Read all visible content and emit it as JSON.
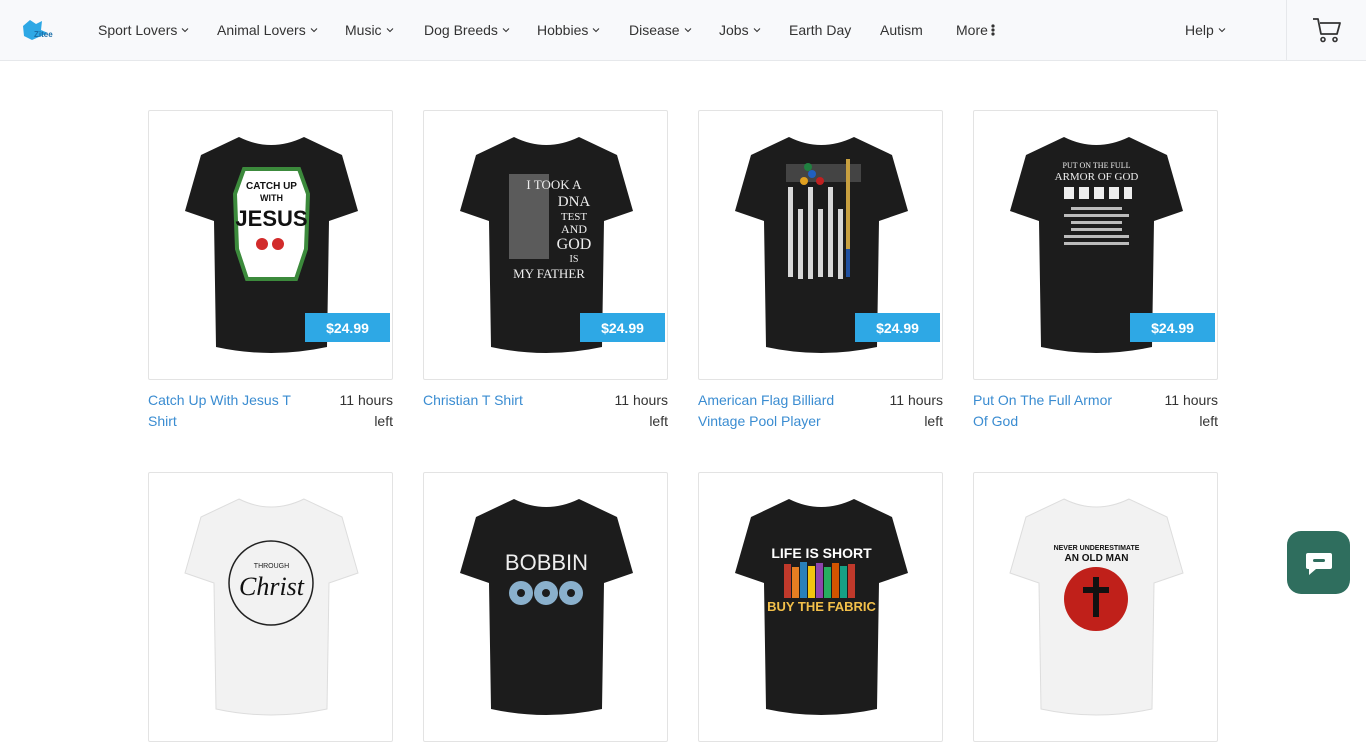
{
  "header": {
    "logo_text": "Zitee",
    "nav": [
      {
        "label": "Sport Lovers",
        "has_dropdown": true
      },
      {
        "label": "Animal Lovers",
        "has_dropdown": true
      },
      {
        "label": "Music",
        "has_dropdown": true
      },
      {
        "label": "Dog Breeds",
        "has_dropdown": true
      },
      {
        "label": "Hobbies",
        "has_dropdown": true
      },
      {
        "label": "Disease",
        "has_dropdown": true
      },
      {
        "label": "Jobs",
        "has_dropdown": true
      },
      {
        "label": "Earth Day",
        "has_dropdown": false
      },
      {
        "label": "Autism",
        "has_dropdown": false
      },
      {
        "label": "More",
        "has_dropdown": false
      }
    ],
    "help_label": "Help",
    "cart_icon": "cart-icon"
  },
  "products": [
    {
      "title": "Catch Up With Jesus T Shirt",
      "price": "$24.99",
      "time_left": "11 hours left",
      "shirt_color": "#1c1c1c",
      "print": [
        "CATCH UP",
        "WITH",
        "JESUS"
      ]
    },
    {
      "title": "Christian T Shirt",
      "price": "$24.99",
      "time_left": "11 hours left",
      "shirt_color": "#1c1c1c",
      "print": [
        "I TOOK A",
        "DNA",
        "TEST",
        "AND",
        "GOD",
        "IS",
        "MY FATHER"
      ]
    },
    {
      "title": "American Flag Billiard Vintage Pool Player",
      "price": "$24.99",
      "time_left": "11 hours left",
      "shirt_color": "#1c1c1c",
      "print": []
    },
    {
      "title": "Put On The Full Armor Of God",
      "price": "$24.99",
      "time_left": "11 hours left",
      "shirt_color": "#1c1c1c",
      "print": [
        "PUT ON THE FULL",
        "ARMOR OF GOD"
      ]
    },
    {
      "shirt_color": "#f2f2f2",
      "print": [
        "THROUGH",
        "Christ"
      ]
    },
    {
      "shirt_color": "#1c1c1c",
      "print": [
        "BOBBIN"
      ]
    },
    {
      "shirt_color": "#1c1c1c",
      "print": [
        "LIFE IS SHORT",
        "BUY THE FABRIC"
      ]
    },
    {
      "shirt_color": "#f2f2f2",
      "print": [
        "NEVER UNDERESTIMATE",
        "AN OLD MAN"
      ]
    }
  ],
  "colors": {
    "accent": "#2ea8e5",
    "link": "#3a8cd1",
    "chat": "#2f6e5e"
  },
  "chat_icon": "chat-bubble-icon"
}
